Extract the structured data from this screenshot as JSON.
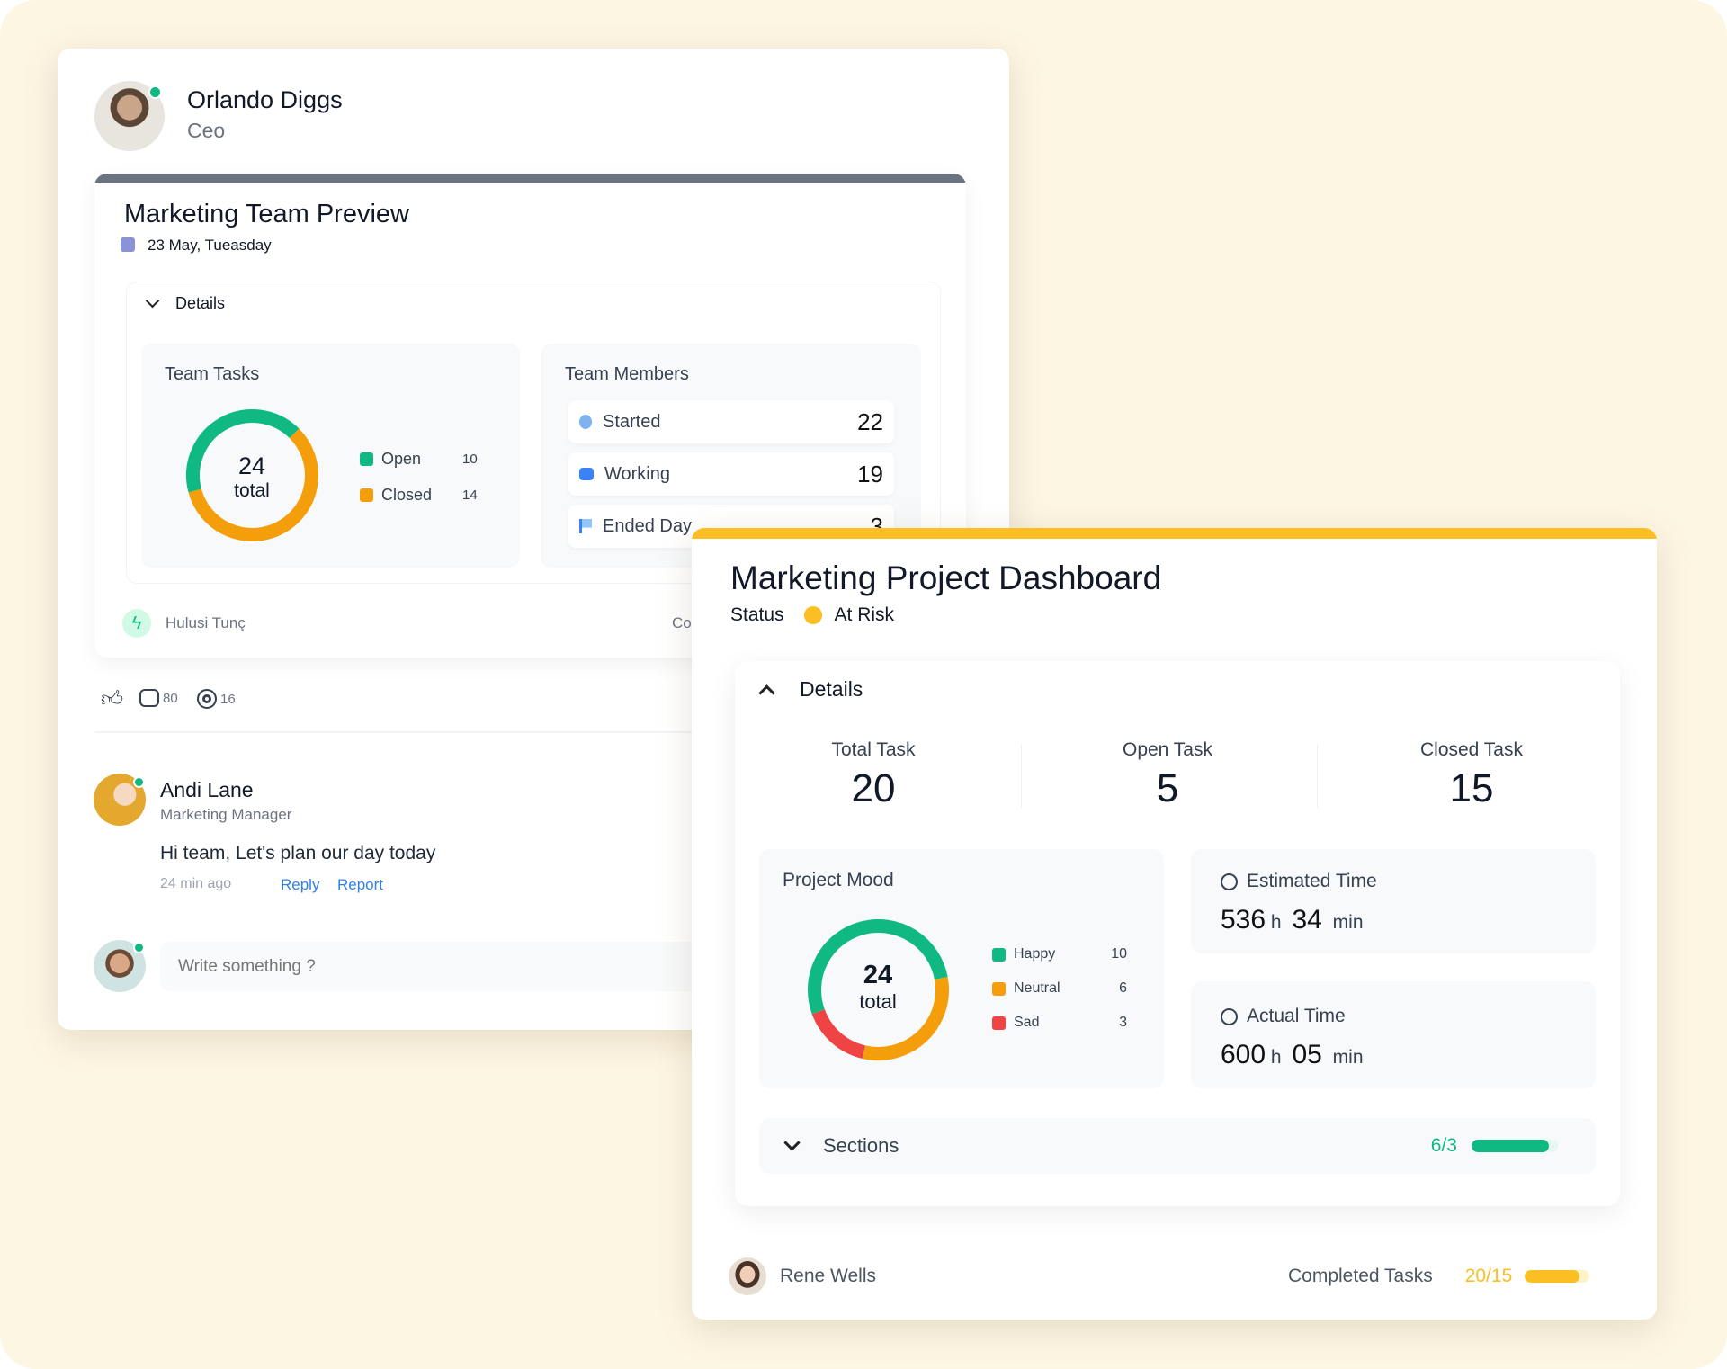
{
  "profile": {
    "name": "Orlando Diggs",
    "role": "Ceo"
  },
  "team_preview": {
    "title": "Marketing Team Preview",
    "date": "23 May, Tueasday",
    "details_label": "Details",
    "team_tasks": {
      "label": "Team Tasks",
      "total": "24",
      "total_label": "total",
      "legend": [
        {
          "label": "Open",
          "value": 10,
          "color": "#10b981"
        },
        {
          "label": "Closed",
          "value": 14,
          "color": "#f59e0b"
        }
      ]
    },
    "team_members": {
      "label": "Team Members",
      "rows": [
        {
          "label": "Started",
          "value": "22",
          "icon": "stopwatch-icon"
        },
        {
          "label": "Working",
          "value": "19",
          "icon": "briefcase-icon"
        },
        {
          "label": "Ended Day",
          "value": "3",
          "icon": "flag-icon"
        }
      ]
    },
    "footer_user": "Hulusi Tunç",
    "footer_right": "Co"
  },
  "reactions": {
    "comments": "80",
    "views": "16"
  },
  "comment": {
    "name": "Andi Lane",
    "role": "Marketing Manager",
    "text": "Hi team, Let's plan our day today",
    "time": "24 min ago",
    "reply": "Reply",
    "report": "Report"
  },
  "composer": {
    "placeholder": "Write something ?"
  },
  "dashboard": {
    "title": "Marketing Project Dashboard",
    "status_label": "Status",
    "status": "At Risk",
    "status_color": "#fbbf24",
    "details_label": "Details",
    "stats": [
      {
        "label": "Total Task",
        "value": "20"
      },
      {
        "label": "Open Task",
        "value": "5"
      },
      {
        "label": "Closed Task",
        "value": "15"
      }
    ],
    "mood": {
      "label": "Project Mood",
      "total": "24",
      "total_label": "total",
      "legend": [
        {
          "label": "Happy",
          "value": 10,
          "color": "#10b981"
        },
        {
          "label": "Neutral",
          "value": 6,
          "color": "#f59e0b"
        },
        {
          "label": "Sad",
          "value": 3,
          "color": "#ef4444"
        }
      ]
    },
    "estimated": {
      "label": "Estimated Time",
      "hours": "536",
      "h": "h",
      "minutes": "34",
      "min": "min"
    },
    "actual": {
      "label": "Actual Time",
      "hours": "600",
      "h": "h",
      "minutes": "05",
      "min": "min"
    },
    "sections": {
      "label": "Sections",
      "progress_text": "6/3",
      "progress": 1.0
    },
    "footer_user": "Rene Wells",
    "completed_label": "Completed Tasks",
    "completed_text": "20/15",
    "completed_progress": 1.0
  }
}
